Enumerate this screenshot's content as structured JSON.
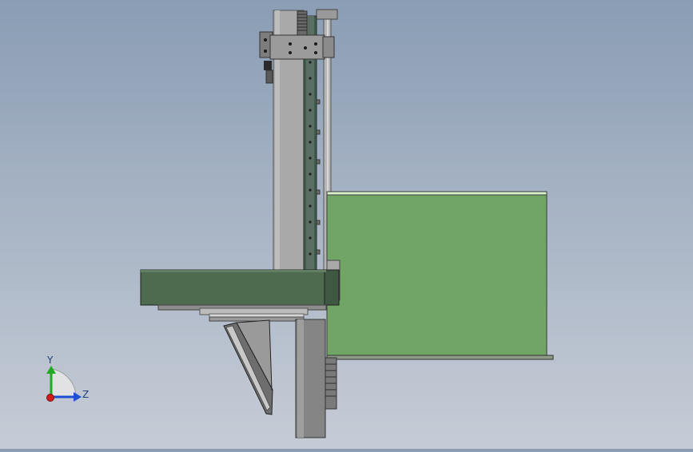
{
  "viewport": {
    "background_top": "#8a9db4",
    "background_bottom": "#c6ccd6"
  },
  "triad": {
    "y_label": "Y",
    "z_label": "Z",
    "y_color": "#22aa22",
    "z_color": "#1f4fd1",
    "x_color": "#d01c1c"
  },
  "colors": {
    "steel_light": "#a9a9a9",
    "steel_mid": "#8c8c8c",
    "steel_dark": "#5a5a5a",
    "rail_green": "#3e5e4d",
    "tank_green": "#71a566",
    "plate_green": "#4e6b50"
  }
}
